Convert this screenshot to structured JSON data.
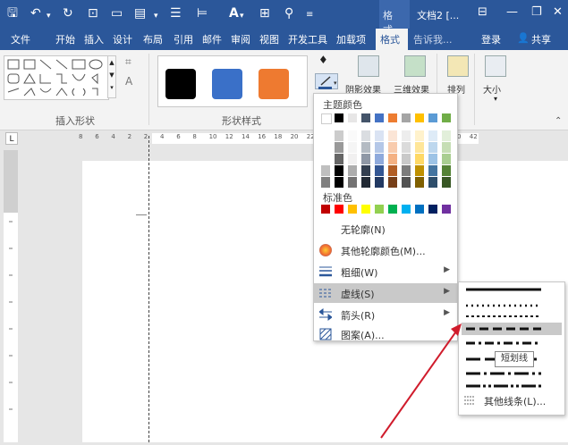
{
  "title_bar": {
    "context_tab": "格式...",
    "doc_title": "文档2 [...",
    "qat_icons": [
      "save-icon",
      "undo-icon",
      "redo-icon",
      "format-painter-icon",
      "new-doc-icon",
      "paste-icon",
      "align-icon",
      "indent-icon",
      "font-color-icon",
      "table-icon",
      "find-icon"
    ]
  },
  "tabs": [
    "文件",
    "开始",
    "插入",
    "设计",
    "布局",
    "引用",
    "邮件",
    "审阅",
    "视图",
    "开发工具",
    "加载项",
    "格式"
  ],
  "tell_me": "告诉我...",
  "login": "登录",
  "share": "共享",
  "ribbon": {
    "group_shapes_label": "插入形状",
    "group_style_label": "形状样式",
    "swatch_colors": [
      "#000000",
      "#3a70c8",
      "#ee7a30"
    ],
    "shadow_effect": "阴影效果",
    "threed_effect": "三维效果",
    "arrange": "排列",
    "size": "大小"
  },
  "ruler": {
    "numbers": [
      "8",
      "6",
      "4",
      "2",
      "2",
      "4",
      "6",
      "8",
      "10",
      "12",
      "14",
      "16",
      "18",
      "20",
      "22",
      "24",
      "26",
      "28",
      "30",
      "32",
      "34",
      "36",
      "38",
      "40",
      "42"
    ]
  },
  "menu": {
    "theme_colors_label": "主题颜色",
    "standard_colors_label": "标准色",
    "theme_top_colors": [
      "#ffffff",
      "#000000",
      "#e7e6e6",
      "#44546a",
      "#4472c4",
      "#ed7d31",
      "#a5a5a5",
      "#ffc000",
      "#5b9bd5",
      "#70ad47"
    ],
    "standard_colors": [
      "#c00000",
      "#ff0000",
      "#ffc000",
      "#ffff00",
      "#92d050",
      "#00b050",
      "#00b0f0",
      "#0070c0",
      "#002060",
      "#7030a0"
    ],
    "items": [
      {
        "label": "无轮廓(N)",
        "icon": "no-outline-icon"
      },
      {
        "label": "其他轮廓颜色(M)...",
        "icon": "color-wheel-icon"
      },
      {
        "label": "粗细(W)",
        "icon": "weight-icon"
      },
      {
        "label": "虚线(S)",
        "icon": "dash-icon"
      },
      {
        "label": "箭头(R)",
        "icon": "arrow-icon"
      },
      {
        "label": "图案(A)...",
        "icon": "pattern-icon"
      }
    ]
  },
  "submenu": {
    "tooltip": "短划线",
    "more_lines": "其他线条(L)..."
  }
}
